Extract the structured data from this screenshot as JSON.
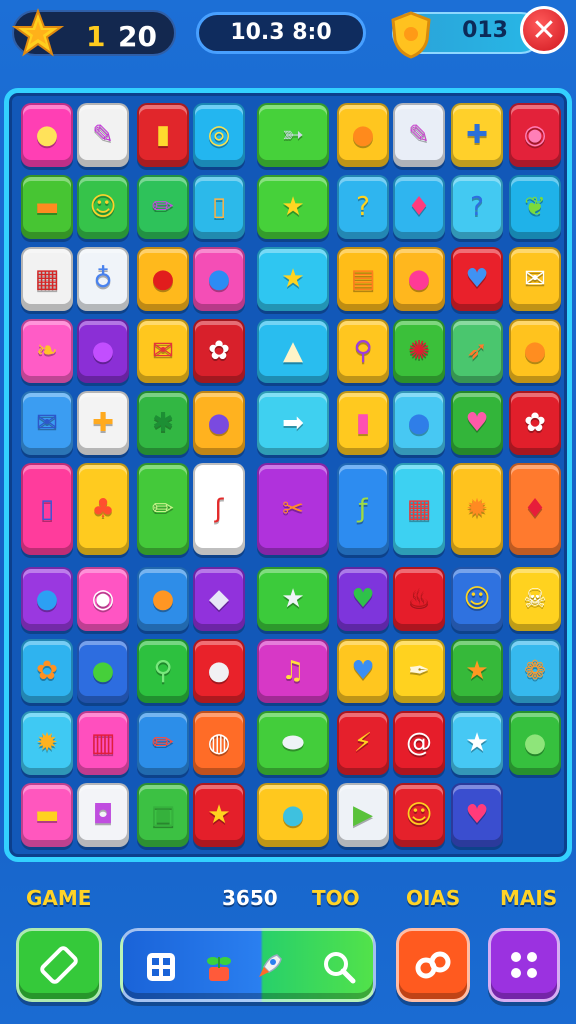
{
  "hud": {
    "level": "1",
    "score": "20",
    "timer": "10.3 8:0",
    "coins": "013"
  },
  "colors": {
    "accent": "#33d1ff",
    "gold": "#ffd327",
    "close": "#d0171f"
  },
  "board": {
    "tiles": [
      {
        "icon": "lemon-icon",
        "glyph": "●",
        "bg": "#ff3fb4",
        "fg": "#ffe25a"
      },
      {
        "icon": "pushpin-icon",
        "glyph": "✎",
        "bg": "#f2f2f2",
        "fg": "#c338d8"
      },
      {
        "icon": "jar-icon",
        "glyph": "▮",
        "bg": "#e1262b",
        "fg": "#ffd92e"
      },
      {
        "icon": "ring-icon",
        "glyph": "◎",
        "bg": "#23b6f0",
        "fg": "#ffe14a"
      },
      {
        "icon": "fish-icon",
        "glyph": "➳",
        "bg": "#46d13a",
        "fg": "#cfd7e6"
      },
      {
        "icon": "orange-ball-icon",
        "glyph": "●",
        "bg": "#ffc61f",
        "fg": "#ff8a1c"
      },
      {
        "icon": "pencil-icon",
        "glyph": "✎",
        "bg": "#e9eef7",
        "fg": "#c94acd"
      },
      {
        "icon": "tools-icon",
        "glyph": "✚",
        "bg": "#ffd02a",
        "fg": "#2b6fd9"
      },
      {
        "icon": "candy-icon",
        "glyph": "◉",
        "bg": "#e3223a",
        "fg": "#ff7fb7"
      },
      {
        "icon": "carrot-icon",
        "glyph": "▬",
        "bg": "#47c533",
        "fg": "#ff8b20"
      },
      {
        "icon": "smiley-icon",
        "glyph": "☺",
        "bg": "#36c34a",
        "fg": "#ffd12b"
      },
      {
        "icon": "crayon-icon",
        "glyph": "✏",
        "bg": "#2ec25a",
        "fg": "#c24adf"
      },
      {
        "icon": "beer-icon",
        "glyph": "▯",
        "bg": "#2cb9ea",
        "fg": "#ffb548"
      },
      {
        "icon": "star-icon",
        "glyph": "★",
        "bg": "#46d13a",
        "fg": "#ffd622"
      },
      {
        "icon": "question-icon",
        "glyph": "?",
        "bg": "#2fb5ef",
        "fg": "#ffd41f"
      },
      {
        "icon": "balloon-icon",
        "glyph": "♦",
        "bg": "#2fb5ef",
        "fg": "#ff3c7d"
      },
      {
        "icon": "question2-icon",
        "glyph": "?",
        "bg": "#43c9f2",
        "fg": "#2d6fe0"
      },
      {
        "icon": "feather-icon",
        "glyph": "❦",
        "bg": "#1fb2e9",
        "fg": "#7bdb3b"
      },
      {
        "icon": "calendar-icon",
        "glyph": "▦",
        "bg": "#f2f2f2",
        "fg": "#d32626"
      },
      {
        "icon": "pin-icon",
        "glyph": "♁",
        "bg": "#f0f4f9",
        "fg": "#4a82ee"
      },
      {
        "icon": "red-ball-icon",
        "glyph": "●",
        "bg": "#ffb91c",
        "fg": "#e11d1d"
      },
      {
        "icon": "blueberry-icon",
        "glyph": "●",
        "bg": "#f44eb6",
        "fg": "#2c8cf4"
      },
      {
        "icon": "gold-star-icon",
        "glyph": "★",
        "bg": "#2fc6f1",
        "fg": "#ffd420"
      },
      {
        "icon": "battery-icon",
        "glyph": "▤",
        "bg": "#ffbd18",
        "fg": "#ff7e1e"
      },
      {
        "icon": "pink-balloon-icon",
        "glyph": "●",
        "bg": "#ffb71e",
        "fg": "#ff3a96"
      },
      {
        "icon": "heart-icon",
        "glyph": "♥",
        "bg": "#e9212b",
        "fg": "#3f92f3"
      },
      {
        "icon": "mail-icon",
        "glyph": "✉",
        "bg": "#ffc41e",
        "fg": "#ffffff"
      },
      {
        "icon": "leaf-icon",
        "glyph": "❧",
        "bg": "#ff5cc6",
        "fg": "#ffc22a"
      },
      {
        "icon": "bird-icon",
        "glyph": "●",
        "bg": "#8b2fd6",
        "fg": "#c24eff"
      },
      {
        "icon": "envelope-red-icon",
        "glyph": "✉",
        "bg": "#ffc71e",
        "fg": "#e3353a"
      },
      {
        "icon": "bone-icon",
        "glyph": "✿",
        "bg": "#d8202b",
        "fg": "#ffffff"
      },
      {
        "icon": "tent-icon",
        "glyph": "▲",
        "bg": "#29bdef",
        "fg": "#fff4c8"
      },
      {
        "icon": "magnifier-icon",
        "glyph": "⚲",
        "bg": "#ffc61f",
        "fg": "#9e3edb"
      },
      {
        "icon": "flower-red-icon",
        "glyph": "✺",
        "bg": "#3bc03a",
        "fg": "#de1e31"
      },
      {
        "icon": "feather-brown-icon",
        "glyph": "➶",
        "bg": "#4ac66e",
        "fg": "#ff7a2c"
      },
      {
        "icon": "orange-balloon-icon",
        "glyph": "●",
        "bg": "#ffc31e",
        "fg": "#ff8d20"
      },
      {
        "icon": "envelope-blue-icon",
        "glyph": "✉",
        "bg": "#3b9df2",
        "fg": "#2e57c9"
      },
      {
        "icon": "cross-icon",
        "glyph": "✚",
        "bg": "#f3f3f3",
        "fg": "#ffaa1f"
      },
      {
        "icon": "palm-icon",
        "glyph": "✱",
        "bg": "#32b743",
        "fg": "#1d8f34"
      },
      {
        "icon": "planet-icon",
        "glyph": "●",
        "bg": "#ffb21f",
        "fg": "#7a4ae0"
      },
      {
        "icon": "arrow-right-icon",
        "glyph": "➡",
        "bg": "#3fd0f0",
        "fg": "#ffffff"
      },
      {
        "icon": "candle-icon",
        "glyph": "▮",
        "bg": "#ffc91f",
        "fg": "#ff4fb2"
      },
      {
        "icon": "bubble-icon",
        "glyph": "●",
        "bg": "#47c8f3",
        "fg": "#2f7ee8"
      },
      {
        "icon": "heart-green-icon",
        "glyph": "♥",
        "bg": "#33b53a",
        "fg": "#ff5aa8"
      },
      {
        "icon": "daisy-icon",
        "glyph": "✿",
        "bg": "#e11f2b",
        "fg": "#ffffff"
      },
      {
        "icon": "sprayer-icon",
        "glyph": "▯",
        "bg": "#ff3c9c",
        "fg": "#3b58d6"
      },
      {
        "icon": "tree-icon",
        "glyph": "♣",
        "bg": "#ffcb1f",
        "fg": "#ff4f2e"
      },
      {
        "icon": "crayon-green-icon",
        "glyph": "✏",
        "bg": "#44c93a",
        "fg": "#c6f28a"
      },
      {
        "icon": "ribbon-icon",
        "glyph": "ʃ",
        "bg": "#ffffff",
        "fg": "#e42a2a"
      },
      {
        "icon": "wrench-icon",
        "glyph": "✂",
        "bg": "#b032dc",
        "fg": "#ff8a2a"
      },
      {
        "icon": "brush-icon",
        "glyph": "ƒ",
        "bg": "#2d8cf0",
        "fg": "#9fdb45"
      },
      {
        "icon": "calendar-grid-icon",
        "glyph": "▦",
        "bg": "#3dd1f2",
        "fg": "#e83b3b"
      },
      {
        "icon": "sun-icon",
        "glyph": "✹",
        "bg": "#ffc31e",
        "fg": "#ff8a22"
      },
      {
        "icon": "drop-icon",
        "glyph": "♦",
        "bg": "#ff7a2e",
        "fg": "#e71d3a"
      },
      {
        "icon": "lollipop-icon",
        "glyph": "●",
        "bg": "#9a38e0",
        "fg": "#2ca0f3"
      },
      {
        "icon": "donut-icon",
        "glyph": "◉",
        "bg": "#ff55c3",
        "fg": "#ffffff"
      },
      {
        "icon": "pumpkin-icon",
        "glyph": "●",
        "bg": "#2e8de8",
        "fg": "#ff9623"
      },
      {
        "icon": "cube-icon",
        "glyph": "◆",
        "bg": "#9132dc",
        "fg": "#e7e7f7"
      },
      {
        "icon": "silver-star-icon",
        "glyph": "★",
        "bg": "#3ccb3b",
        "fg": "#eef3f7"
      },
      {
        "icon": "green-heart-icon",
        "glyph": "♥",
        "bg": "#7e35dc",
        "fg": "#2fc24a"
      },
      {
        "icon": "key-icon",
        "glyph": "♨",
        "bg": "#e61d2a",
        "fg": "#b71519"
      },
      {
        "icon": "face-icon",
        "glyph": "☺",
        "bg": "#2f72e0",
        "fg": "#ffd51f"
      },
      {
        "icon": "skull-icon",
        "glyph": "☠",
        "bg": "#ffd21f",
        "fg": "#ffffff"
      },
      {
        "icon": "flower-orange-icon",
        "glyph": "✿",
        "bg": "#2fb3ef",
        "fg": "#ff9120"
      },
      {
        "icon": "green-ball-icon",
        "glyph": "●",
        "bg": "#2d6de0",
        "fg": "#46cf3a"
      },
      {
        "icon": "search-icon",
        "glyph": "⚲",
        "bg": "#2dc13f",
        "fg": "#79e77d"
      },
      {
        "icon": "pearl-icon",
        "glyph": "●",
        "bg": "#e9222a",
        "fg": "#f1f1f4"
      },
      {
        "icon": "music-icon",
        "glyph": "♫",
        "bg": "#d738c6",
        "fg": "#ffe03b"
      },
      {
        "icon": "blue-heart-icon",
        "glyph": "♥",
        "bg": "#ffc61f",
        "fg": "#3a8ef3"
      },
      {
        "icon": "quill-icon",
        "glyph": "✒",
        "bg": "#ffd21f",
        "fg": "#fff7dd"
      },
      {
        "icon": "orange-star-icon",
        "glyph": "★",
        "bg": "#36b93a",
        "fg": "#ff9822"
      },
      {
        "icon": "shell-icon",
        "glyph": "❁",
        "bg": "#36b9ee",
        "fg": "#ff9a2a"
      },
      {
        "icon": "sunflower-icon",
        "glyph": "✹",
        "bg": "#3fc9f3",
        "fg": "#ffb21f"
      },
      {
        "icon": "barrel-icon",
        "glyph": "▥",
        "bg": "#ff4fbe",
        "fg": "#e21d3b"
      },
      {
        "icon": "marker-icon",
        "glyph": "✏",
        "bg": "#2c8ee9",
        "fg": "#ff4b3a"
      },
      {
        "icon": "robot-icon",
        "glyph": "◍",
        "bg": "#ff6c27",
        "fg": "#ffffff"
      },
      {
        "icon": "larva-icon",
        "glyph": "⬬",
        "bg": "#43cd3b",
        "fg": "#eef3f7"
      },
      {
        "icon": "lightning-icon",
        "glyph": "⚡",
        "bg": "#e5202c",
        "fg": "#ffd21f"
      },
      {
        "icon": "snail-icon",
        "glyph": "@",
        "bg": "#e61d2a",
        "fg": "#ffffff"
      },
      {
        "icon": "white-star-icon",
        "glyph": "★",
        "bg": "#46c8f4",
        "fg": "#ffffff"
      },
      {
        "icon": "speech-icon",
        "glyph": "●",
        "bg": "#36c03e",
        "fg": "#8ee57a"
      },
      {
        "icon": "rainbow-bar-icon",
        "glyph": "▬",
        "bg": "#ff57be",
        "fg": "#ffd21f"
      },
      {
        "icon": "lock-icon",
        "glyph": "◘",
        "bg": "#f3f4f8",
        "fg": "#c04de0"
      },
      {
        "icon": "green-box-icon",
        "glyph": "▣",
        "bg": "#3cc143",
        "fg": "#35b13c"
      },
      {
        "icon": "red-star-icon",
        "glyph": "★",
        "bg": "#e41f2a",
        "fg": "#ffd21f"
      },
      {
        "icon": "teal-balloon-icon",
        "glyph": "●",
        "bg": "#ffc81e",
        "fg": "#3ec1df"
      },
      {
        "icon": "play-icon",
        "glyph": "▶",
        "bg": "#eef2f7",
        "fg": "#59c23a"
      },
      {
        "icon": "yellow-face-icon",
        "glyph": "☺",
        "bg": "#e5212b",
        "fg": "#ffd21f"
      },
      {
        "icon": "pretzel-icon",
        "glyph": "♥",
        "bg": "#3a4ecf",
        "fg": "#ff3b7a"
      }
    ]
  },
  "footer": {
    "game_label": "GAME",
    "score_label": "3650",
    "too_label": "TOO",
    "oias_label": "OIAS",
    "mais_label": "MAIS"
  }
}
